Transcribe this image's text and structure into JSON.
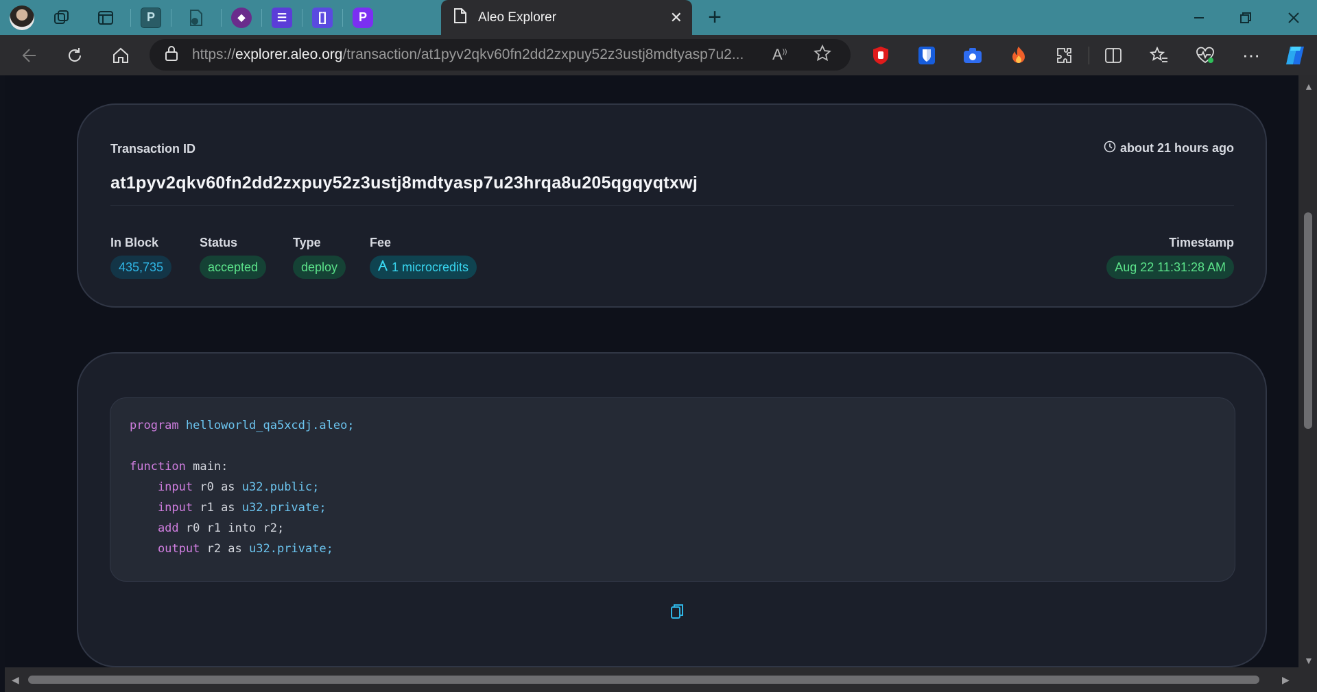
{
  "browser": {
    "tab_title": "Aleo Explorer",
    "url_prefix": "https://",
    "url_domain": "explorer.aleo.org",
    "url_path": "/transaction/at1pyv2qkv60fn2dd2zxpuy52z3ustj8mdtyasp7u2...",
    "pinned_tabs": [
      {
        "name": "workspaces-icon"
      },
      {
        "name": "tab-actions-icon"
      },
      {
        "name": "p-app-icon"
      },
      {
        "name": "tab-closed-icon"
      },
      {
        "name": "shield-app-icon"
      },
      {
        "name": "list-app-icon"
      },
      {
        "name": "bracket-app-icon"
      },
      {
        "name": "purple-p-app-icon"
      }
    ],
    "extensions": [
      "ublock-icon",
      "bitwarden-icon",
      "camera-icon",
      "fire-icon",
      "extensions-icon",
      "split-screen-icon",
      "favorites-icon",
      "health-icon",
      "more-icon",
      "copilot-icon"
    ]
  },
  "transaction": {
    "id_label": "Transaction ID",
    "id": "at1pyv2qkv60fn2dd2zxpuy52z3ustj8mdtyasp7u23hrqa8u205qgqyqtxwj",
    "time_ago": "about 21 hours ago",
    "fields": {
      "block_label": "In Block",
      "block_value": "435,735",
      "status_label": "Status",
      "status_value": "accepted",
      "type_label": "Type",
      "type_value": "deploy",
      "fee_label": "Fee",
      "fee_value": "1 microcredits",
      "timestamp_label": "Timestamp",
      "timestamp_value": "Aug 22 11:31:28 AM"
    }
  },
  "program": {
    "lines": [
      {
        "kw": "program",
        "rest": " ",
        "ty": "helloworld_qa5xcdj.aleo;"
      },
      {
        "kw": "",
        "rest": "",
        "ty": ""
      },
      {
        "kw": "function",
        "rest": " main:",
        "ty": ""
      },
      {
        "kw": "    input",
        "rest": " r0 as ",
        "ty": "u32.public;"
      },
      {
        "kw": "    input",
        "rest": " r1 as ",
        "ty": "u32.private;"
      },
      {
        "kw": "    add",
        "rest": " r0 r1 into r2;",
        "ty": ""
      },
      {
        "kw": "    output",
        "rest": " r2 as ",
        "ty": "u32.private;"
      }
    ]
  },
  "colors": {
    "accent_blue": "#2fb6e6",
    "accent_green": "#5be38a",
    "keyword": "#d07ee0",
    "type": "#6cc5f0"
  }
}
